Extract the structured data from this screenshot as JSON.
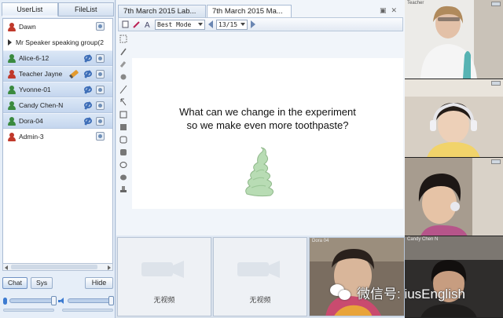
{
  "left_panel": {
    "tabs": [
      "UserList",
      "FileList"
    ],
    "users": [
      {
        "name": "Dawn",
        "type": "user",
        "color": "red",
        "highlight": false,
        "tools": false,
        "pencil": false
      },
      {
        "name": "Mr Speaker speaking group(2",
        "type": "group",
        "highlight": false
      },
      {
        "name": "Alice-6-12",
        "type": "user",
        "color": "green",
        "highlight": true,
        "tools": true,
        "pencil": false
      },
      {
        "name": "Teacher Jayne",
        "type": "user",
        "color": "red",
        "highlight": true,
        "tools": true,
        "pencil": true
      },
      {
        "name": "Yvonne-01",
        "type": "user",
        "color": "green",
        "highlight": true,
        "tools": true,
        "pencil": false
      },
      {
        "name": "Candy Chen-N",
        "type": "user",
        "color": "green",
        "highlight": true,
        "tools": true,
        "pencil": false
      },
      {
        "name": "Dora-04",
        "type": "user",
        "color": "green",
        "highlight": true,
        "tools": true,
        "pencil": false
      },
      {
        "name": "Admin-3",
        "type": "user",
        "color": "red",
        "highlight": false,
        "tools": false,
        "pencil": false
      }
    ],
    "bottom_tabs": [
      "Chat",
      "Sys"
    ],
    "hide_label": "Hide"
  },
  "whiteboard": {
    "doc_tabs": [
      "7th March 2015 Lab...",
      "7th March 2015 Ma..."
    ],
    "active_tab": 1,
    "mode": "Best Mode",
    "page": "13/15",
    "question_line1": "What can we change in the experiment",
    "question_line2": "so we make even more toothpaste?"
  },
  "video_slots": {
    "no_video_label": "无视频",
    "labels": [
      "",
      "",
      "Dora 04",
      "Candy Chen N"
    ]
  },
  "right_videos": {
    "labels": [
      "Teacher",
      "",
      "",
      ""
    ]
  },
  "watermark": {
    "text": "微信号: iusEnglish"
  },
  "colors": {
    "accent": "#3d7bd1",
    "user_red": "#c0392b",
    "user_green": "#3a8a3f",
    "toothpaste": "#b8dcb4"
  }
}
